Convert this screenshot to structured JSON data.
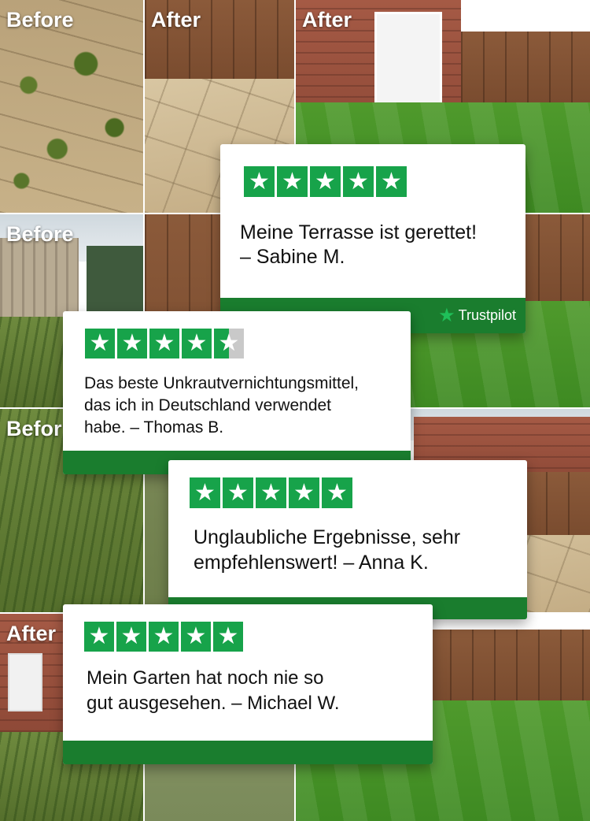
{
  "labels": {
    "tile1": "Before",
    "tile2": "After",
    "tile3": "After",
    "tile4": "Before",
    "tile5": "Befor",
    "tile6": "After"
  },
  "colors": {
    "star_green": "#17a34a",
    "bar_green": "#1a7d2e",
    "trustpilot_star": "#1fbf59"
  },
  "star_glyph": "★",
  "reviews": [
    {
      "stars": 5,
      "text": "Meine Terrasse ist gerettet!\n– Sabine M.",
      "badge": "Trustpilot"
    },
    {
      "stars": 4.5,
      "text": "Das beste Unkrautvernichtungsmittel,\ndas ich in Deutschland verwendet\nhabe.  – Thomas B."
    },
    {
      "stars": 5,
      "text": "Unglaubliche Ergebnisse, sehr\nempfehlenswert! – Anna K."
    },
    {
      "stars": 5,
      "text": "Mein Garten hat noch nie so\ngut ausgesehen. – Michael W."
    }
  ]
}
